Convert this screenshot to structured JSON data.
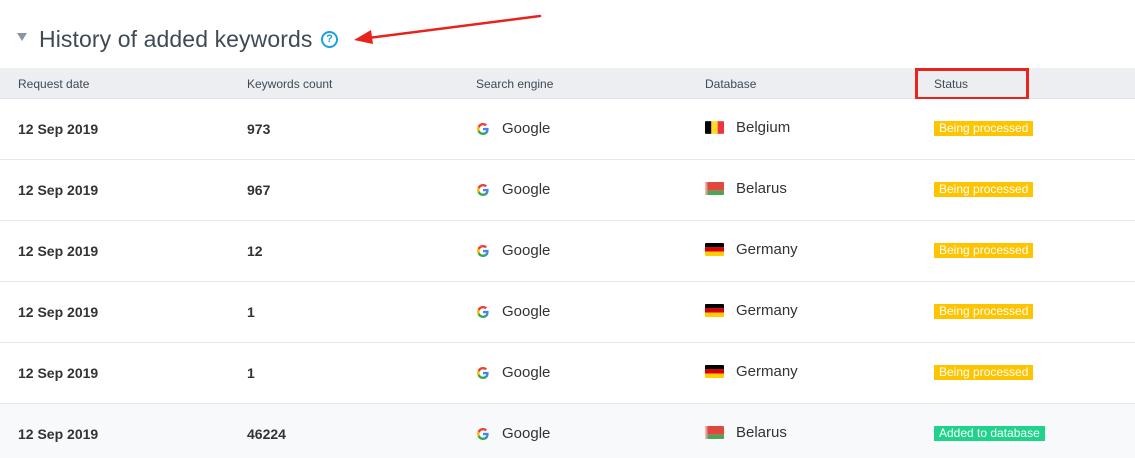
{
  "section": {
    "title": "History of added keywords",
    "help_glyph": "?"
  },
  "table": {
    "columns": [
      "Request date",
      "Keywords count",
      "Search engine",
      "Database",
      "Status"
    ],
    "rows": [
      {
        "date": "12 Sep 2019",
        "count": "973",
        "engine": "Google",
        "database": "Belgium",
        "flag": "belgium-flag-icon",
        "status": "Being processed",
        "status_type": "processing"
      },
      {
        "date": "12 Sep 2019",
        "count": "967",
        "engine": "Google",
        "database": "Belarus",
        "flag": "belarus-flag-icon",
        "status": "Being processed",
        "status_type": "processing"
      },
      {
        "date": "12 Sep 2019",
        "count": "12",
        "engine": "Google",
        "database": "Germany",
        "flag": "germany-flag-icon",
        "status": "Being processed",
        "status_type": "processing"
      },
      {
        "date": "12 Sep 2019",
        "count": "1",
        "engine": "Google",
        "database": "Germany",
        "flag": "germany-flag-icon",
        "status": "Being processed",
        "status_type": "processing"
      },
      {
        "date": "12 Sep 2019",
        "count": "1",
        "engine": "Google",
        "database": "Germany",
        "flag": "germany-flag-icon",
        "status": "Being processed",
        "status_type": "processing"
      },
      {
        "date": "12 Sep 2019",
        "count": "46224",
        "engine": "Google",
        "database": "Belarus",
        "flag": "belarus-flag-icon",
        "status": "Added to database",
        "status_type": "added"
      }
    ]
  },
  "colors": {
    "processing": "#ffc400",
    "added": "#1fd38a",
    "annotation_red": "#e8231d",
    "help_blue": "#1da1dc"
  },
  "icons": {
    "engine": "google-icon",
    "toggle": "collapse-triangle-icon",
    "help": "help-circle-icon",
    "annotation": "red-arrow-annotation"
  }
}
